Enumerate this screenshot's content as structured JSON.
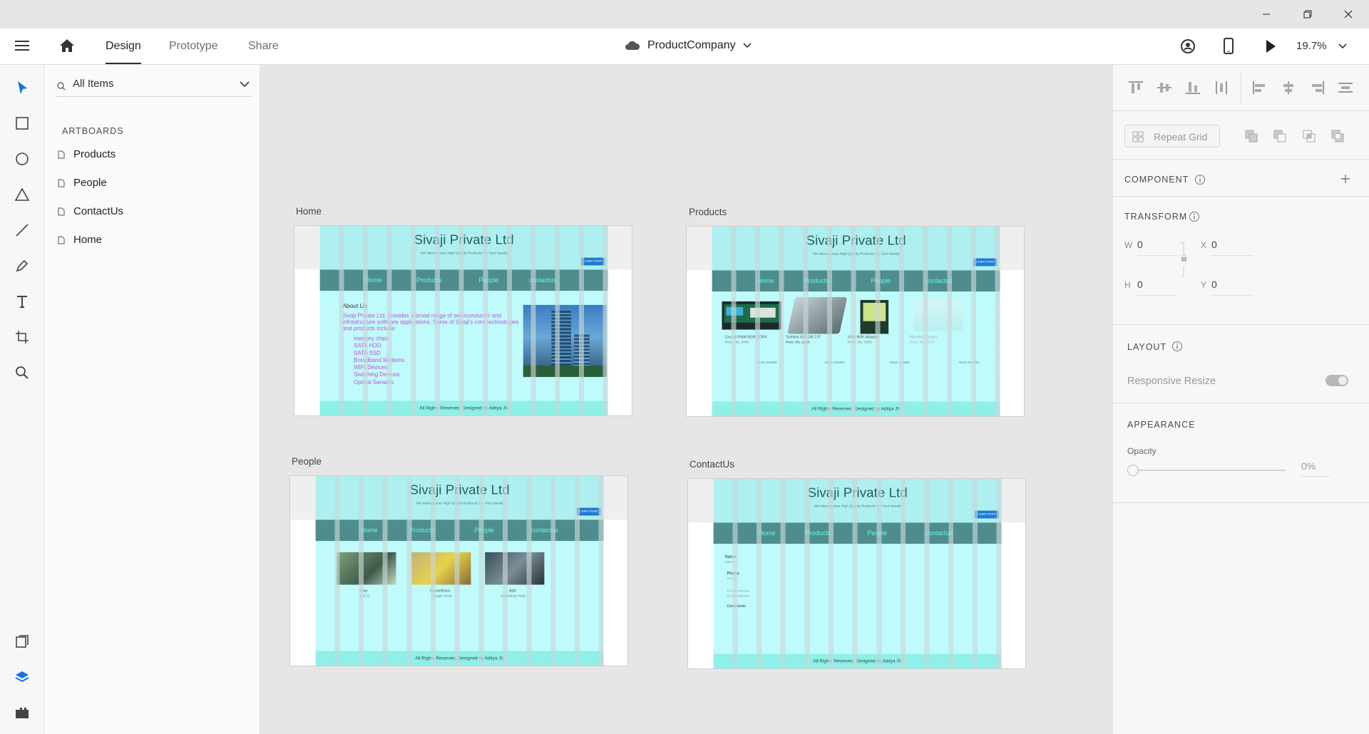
{
  "window": {
    "minimize": "—",
    "maximize": "❐",
    "close": "✕"
  },
  "appbar": {
    "tabs": [
      {
        "label": "Design"
      },
      {
        "label": "Prototype"
      },
      {
        "label": "Share"
      }
    ],
    "document_name": "ProductCompany",
    "zoom": "19.7%"
  },
  "layers": {
    "filter": "All Items",
    "section_title": "ARTBOARDS",
    "items": [
      {
        "label": "Products"
      },
      {
        "label": "People"
      },
      {
        "label": "ContactUs"
      },
      {
        "label": "Home"
      }
    ]
  },
  "canvas": {
    "artboards": {
      "home": {
        "name": "Home"
      },
      "products": {
        "name": "Products"
      },
      "people": {
        "name": "People"
      },
      "contact": {
        "name": "ContactUs"
      }
    },
    "site": {
      "title": "Sivaji Private Ltd",
      "tagline": "We Manufacture High Quality Products For Your Needs",
      "learn_more": "Learn more",
      "nav": [
        "Home",
        "Products",
        "People",
        "contactus"
      ],
      "footer": "All Rights Reserved. Designed by Aditya JV"
    },
    "home": {
      "about_title": "About Us",
      "about_text": "Sivaji Private Ltd, provides a broad range of semiconductor and infrastructure software applications. Some of Sivaji's core technologies and products include:",
      "list": [
        "memory chips",
        "SATA HDD",
        "SATA SSD",
        "Broadband Modems",
        "WIFI Devices",
        "Switching Devices",
        "Optical Sensors"
      ]
    },
    "products": {
      "items": [
        {
          "name": "Crucial RAM 8GB DDR4",
          "price": "Price: Rs. 2400",
          "more": "More Details"
        },
        {
          "name": "Toshiba 500 GB 2.5\"",
          "price": "Price: Rs. 1650",
          "more": "More Details"
        },
        {
          "name": "USB WiFi Adapter",
          "price": "Price: Rs. 2000",
          "more": "More Details"
        },
        {
          "name": "Wireless Router",
          "price": "Price: Rs. 1275",
          "more": "More Details"
        }
      ]
    },
    "people": {
      "members": [
        {
          "name": "Vijay",
          "role": "C.E.O"
        },
        {
          "name": "Nayanthara",
          "role": "Design Head"
        },
        {
          "name": "Ajith",
          "role": "Marketing Head"
        }
      ]
    },
    "contact": {
      "fields": [
        {
          "label": "Name",
          "placeholder": "Name"
        },
        {
          "label": "Phone",
          "placeholder": "Phone"
        },
        {
          "label": "",
          "placeholder": "Email address"
        },
        {
          "label": "",
          "placeholder": "Email address"
        },
        {
          "label": "Comments",
          "placeholder": ""
        }
      ]
    }
  },
  "props": {
    "repeat_grid": "Repeat Grid",
    "component_title": "COMPONENT",
    "transform_title": "TRANSFORM",
    "w_label": "W",
    "w_value": "0",
    "x_label": "X",
    "x_value": "0",
    "h_label": "H",
    "h_value": "0",
    "y_label": "Y",
    "y_value": "0",
    "layout_title": "LAYOUT",
    "responsive_resize": "Responsive Resize",
    "appearance_title": "APPEARANCE",
    "opacity_label": "Opacity",
    "opacity_value": "0%"
  },
  "colors": {
    "accent": "#1473e6",
    "site_bg": "#c0fbfb",
    "site_nav": "#4f8d8d",
    "site_nav_text": "#5ffaf0",
    "site_text_purple": "#c04fd8"
  }
}
